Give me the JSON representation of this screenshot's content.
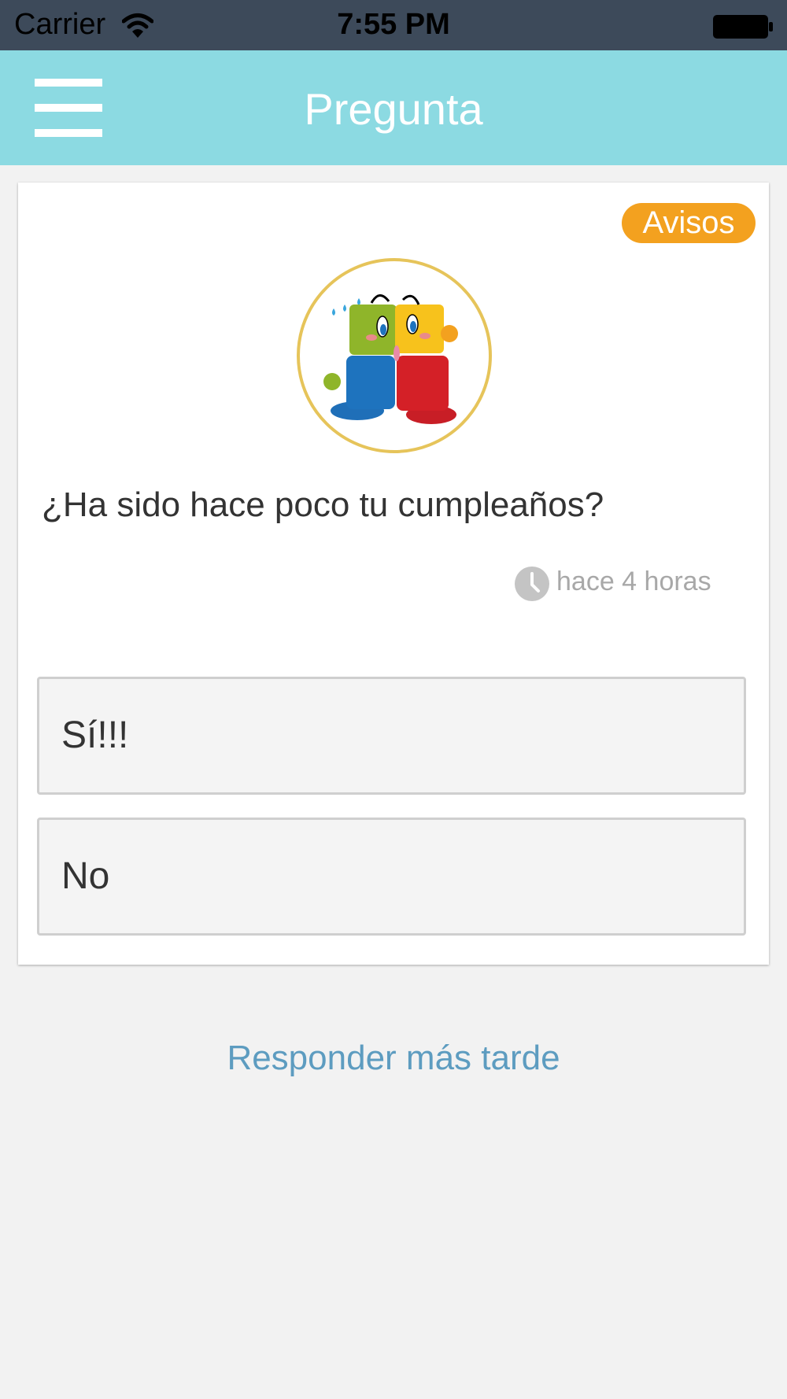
{
  "status_bar": {
    "carrier": "Carrier",
    "time": "7:55 PM"
  },
  "header": {
    "title": "Pregunta",
    "menu_icon": "hamburger-menu-icon"
  },
  "card": {
    "badge": "Avisos",
    "avatar_icon": "cartoon-characters-avatar",
    "question": "¿Ha sido hace poco tu cumpleaños?",
    "time_icon": "clock-icon",
    "time_ago": "hace 4 horas",
    "options": [
      {
        "label": "Sí!!!"
      },
      {
        "label": "No"
      }
    ]
  },
  "footer": {
    "later_link": "Responder más tarde"
  },
  "colors": {
    "status_bar": "#3d4a5a",
    "nav_bar": "#8cdae2",
    "badge": "#f3a11f",
    "link": "#5d9cc0",
    "background": "#f2f2f2"
  }
}
